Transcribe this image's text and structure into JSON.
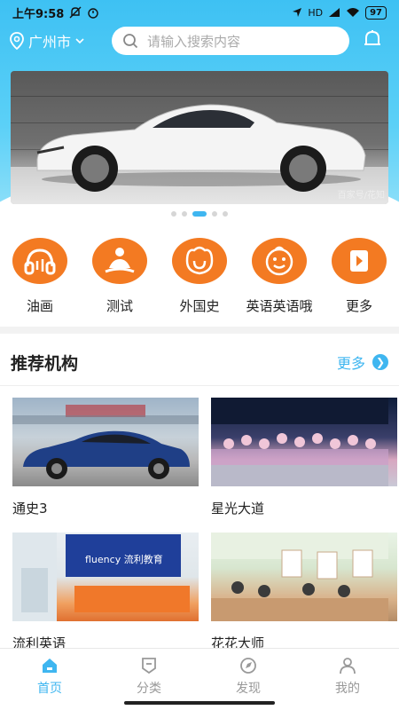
{
  "status_bar": {
    "time": "上午9:58",
    "network": "HD",
    "battery": "97"
  },
  "header": {
    "city": "广州市",
    "search_placeholder": "请输入搜索内容"
  },
  "banner": {
    "caption": "百家号/花知",
    "dot_count": 5,
    "active_dot": 2
  },
  "categories": [
    {
      "label": "油画",
      "icon": "headphones-icon"
    },
    {
      "label": "测试",
      "icon": "meditation-icon"
    },
    {
      "label": "外国史",
      "icon": "bell-flower-icon"
    },
    {
      "label": "英语英语哦",
      "icon": "smiley-face-icon"
    },
    {
      "label": "更多",
      "icon": "more-flag-icon"
    }
  ],
  "section": {
    "title": "推荐机构",
    "more_label": "更多"
  },
  "institutions": [
    {
      "name": "通史3",
      "image": "sedan-car-photo"
    },
    {
      "name": "星光大道",
      "image": "stage-performance-photo"
    },
    {
      "name": "流利英语",
      "image": "english-school-front-desk-photo",
      "sign_text": "fluency 流利教育"
    },
    {
      "name": "花花大师",
      "image": "art-classroom-photo"
    }
  ],
  "tabbar": {
    "items": [
      {
        "label": "首页",
        "icon": "home-icon",
        "active": true
      },
      {
        "label": "分类",
        "icon": "category-icon",
        "active": false
      },
      {
        "label": "发现",
        "icon": "discover-icon",
        "active": false
      },
      {
        "label": "我的",
        "icon": "user-icon",
        "active": false
      }
    ]
  },
  "colors": {
    "primary": "#3fb6f0",
    "accent_orange": "#f37a22",
    "header_blue": "#3ec1f3"
  }
}
